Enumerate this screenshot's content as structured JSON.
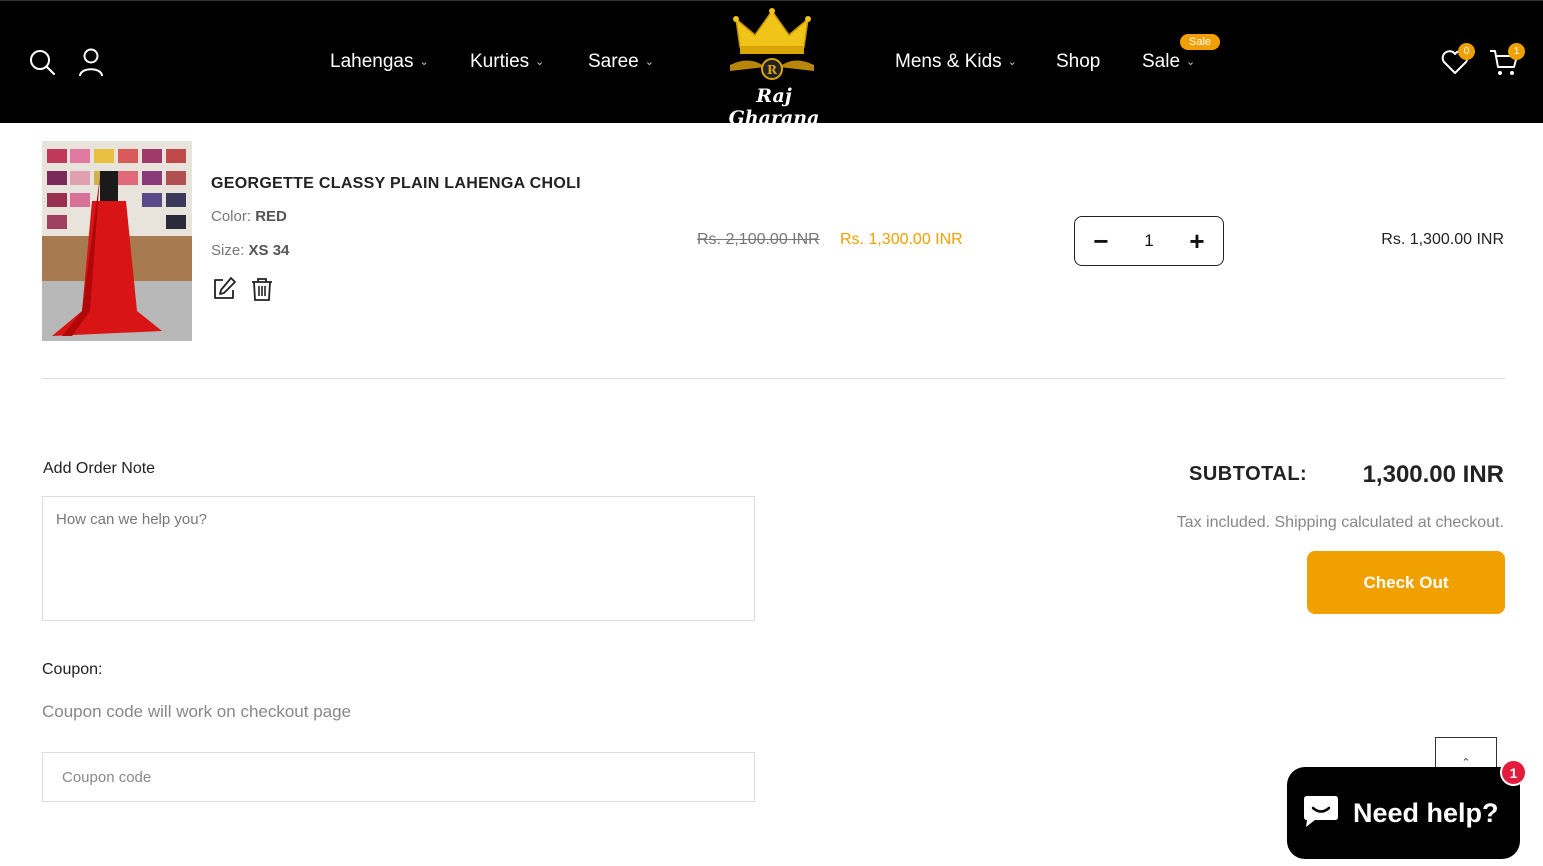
{
  "header": {
    "nav_left": [
      {
        "label": "Lahengas"
      },
      {
        "label": "Kurties"
      },
      {
        "label": "Saree"
      }
    ],
    "nav_right": [
      {
        "label": "Mens & Kids"
      },
      {
        "label": "Shop"
      },
      {
        "label": "Sale"
      }
    ],
    "sale_badge": "Sale",
    "logo_text": "Raj Gharana",
    "wishlist_count": "0",
    "cart_count": "1",
    "icons": [
      "search-icon",
      "account-icon",
      "wishlist-icon",
      "cart-icon"
    ]
  },
  "cart_item": {
    "title": "GEORGETTE CLASSY PLAIN LAHENGA CHOLI",
    "color_label": "Color:",
    "color_value": "RED",
    "size_label": "Size:",
    "size_value": "XS 34",
    "old_price": "Rs. 2,100.00 INR",
    "new_price": "Rs. 1,300.00 INR",
    "quantity": "1",
    "line_total": "Rs. 1,300.00 INR"
  },
  "order_note": {
    "label": "Add Order Note",
    "placeholder": "How can we help you?"
  },
  "coupon": {
    "label": "Coupon:",
    "hint": "Coupon code will work on checkout page",
    "placeholder": "Coupon code"
  },
  "summary": {
    "subtotal_label": "SUBTOTAL:",
    "subtotal_value": "1,300.00 INR",
    "tax_note": "Tax included. Shipping calculated at checkout.",
    "checkout_label": "Check Out"
  },
  "chat": {
    "label": "Need help?",
    "badge": "1"
  },
  "colors": {
    "accent": "#f0a000",
    "header_bg": "#000000",
    "chat_badge": "#e41c3b"
  }
}
